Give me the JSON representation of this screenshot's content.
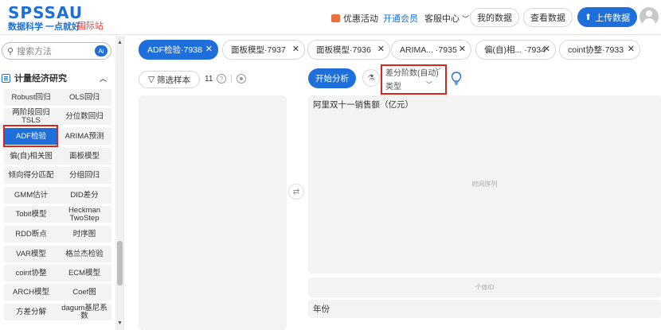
{
  "header": {
    "logo": "SPSSAU",
    "slogan": "数据科学 一点就好",
    "intl_link": "国际站",
    "promo": "优惠活动",
    "member": "开通会员",
    "service": "客服中心",
    "my_data": "我的数据",
    "view_data": "查看数据",
    "upload": "上传数据"
  },
  "sidebar": {
    "search_placeholder": "搜索方法",
    "ai_badge": "Ai",
    "category": "计量经济研究",
    "methods": [
      [
        "Robust回归",
        "OLS回归"
      ],
      [
        "两阶段回归\nTSLS",
        "分位数回归"
      ],
      [
        "ADF检验",
        "ARIMA预测"
      ],
      [
        "偏(自)相关图",
        "面板模型"
      ],
      [
        "倾向得分匹配",
        "分组回归"
      ],
      [
        "GMM估计",
        "DID差分"
      ],
      [
        "Tobit模型",
        "Heckman\nTwoStep"
      ],
      [
        "RDD断点",
        "时序图"
      ],
      [
        "VAR模型",
        "格兰杰检验"
      ],
      [
        "coint协整",
        "ECM模型"
      ],
      [
        "ARCH模型",
        "Coef图"
      ],
      [
        "方差分解",
        "dagum基尼系\n数"
      ]
    ]
  },
  "tabs": [
    {
      "label": "ADF检验·7938",
      "active": true
    },
    {
      "label": "面板模型·7937",
      "active": false
    },
    {
      "label": "面板模型·7936",
      "active": false
    },
    {
      "label": "ARIMA...  ·7935",
      "active": false
    },
    {
      "label": "偏(自)相...  ·7934",
      "active": false
    },
    {
      "label": "coint协整·7933",
      "active": false
    }
  ],
  "toolbar": {
    "filter": "筛选样本",
    "count": "11",
    "start": "开始分析",
    "diff_order": "差分阶数(自动)",
    "type": "类型"
  },
  "analysis": {
    "main_var": "阿里双十一销售额（亿元）",
    "main_placeholder": "时间序列",
    "id_placeholder": "个体ID",
    "year_var": "年份"
  },
  "colors": {
    "brand": "#1e6fd9",
    "highlight": "#d9261c",
    "intl": "#e2453c"
  }
}
